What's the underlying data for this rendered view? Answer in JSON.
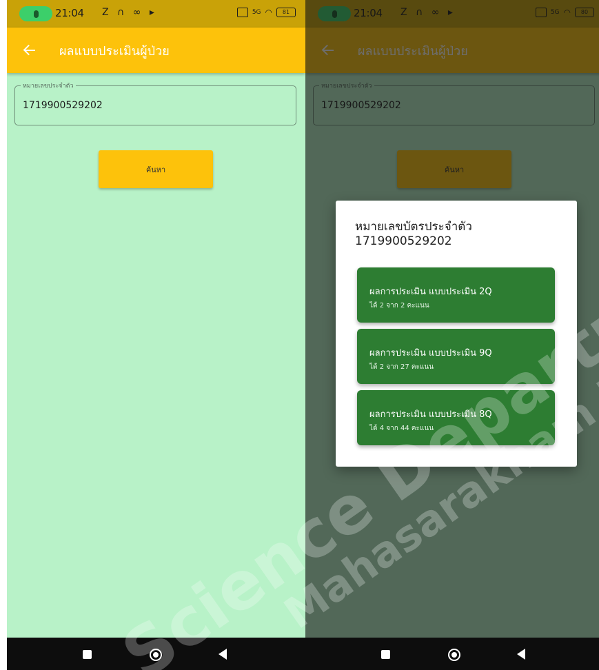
{
  "colors": {
    "body_bg": "#b8f2c8",
    "appbar_bg": "#fdc20b",
    "appbar_bg_dimmed": "#7b5d05",
    "statusbar_bg": "#c9a208",
    "statusbar_bg_dimmed": "#6a5005",
    "mic_pill": "#3ccf6a",
    "result_card": "#2d7d32"
  },
  "status_bar": {
    "time": "21:04",
    "notification_icons": [
      "bell-off-icon",
      "headphones-icon",
      "discord-icon",
      "play-icon"
    ],
    "notif_glyphs": "Z ∩ ∞ ▸",
    "network_label": "5G",
    "battery_left": "81",
    "battery_right": "80"
  },
  "appbar": {
    "title": "ผลแบบประเมินผู้ป่วย"
  },
  "id_field": {
    "label": "หมายเลขประจำตัว",
    "value": "1719900529202"
  },
  "search_button": {
    "label": "ค้นหา"
  },
  "dialog": {
    "title_line1": "หมายเลขบัตรประจำตัว",
    "title_line2": "1719900529202",
    "results": [
      {
        "title": "ผลการประเมิน แบบประเมิน 2Q",
        "score": "ได้ 2 จาก 2 คะแนน"
      },
      {
        "title": "ผลการประเมิน แบบประเมิน 9Q",
        "score": "ได้ 2 จาก 27 คะแนน"
      },
      {
        "title": "ผลการประเมิน แบบประเมิน 8Q",
        "score": "ได้ 4 จาก 44 คะแนน"
      }
    ]
  },
  "watermark": {
    "text_1": "Science Department",
    "text_2": "Mahasarakham University"
  }
}
